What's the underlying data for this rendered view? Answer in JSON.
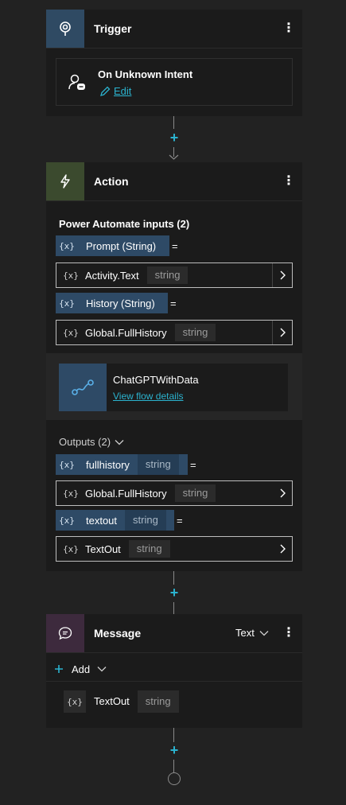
{
  "trigger": {
    "title": "Trigger",
    "kebab": "⋮",
    "intent_title": "On Unknown Intent",
    "edit_label": "Edit"
  },
  "action": {
    "title": "Action",
    "kebab": "⋮",
    "inputs_title": "Power Automate inputs (2)",
    "inputs": [
      {
        "label": "Prompt (String)",
        "value_name": "Activity.Text",
        "value_type": "string"
      },
      {
        "label": "History (String)",
        "value_name": "Global.FullHistory",
        "value_type": "string"
      }
    ],
    "flow_name": "ChatGPTWithData",
    "flow_link": "View flow details",
    "outputs_title": "Outputs (2)",
    "outputs": [
      {
        "var_name": "fullhistory",
        "var_type": "string",
        "value_name": "Global.FullHistory",
        "value_type": "string"
      },
      {
        "var_name": "textout",
        "var_type": "string",
        "value_name": "TextOut",
        "value_type": "string"
      }
    ],
    "var_icon": "{x}",
    "equals": "="
  },
  "message": {
    "title": "Message",
    "kebab": "⋮",
    "mode": "Text",
    "add_label": "Add",
    "var_name": "TextOut",
    "var_type": "string"
  },
  "connectors": {
    "plus": "+"
  },
  "colors": {
    "background": "#222222",
    "card": "#1b1b1b",
    "trigger_accent": "#2f4a63",
    "action_accent": "#3b4a2e",
    "message_accent": "#3d2a3d",
    "var_pill": "#2e4a66",
    "link": "#2bb3cf"
  },
  "icons": {
    "trigger": "trigger-icon",
    "action": "lightning-icon",
    "message": "chat-bubble-icon",
    "intent": "person-chat-icon",
    "edit": "pencil-icon",
    "flow": "flow-icon"
  }
}
